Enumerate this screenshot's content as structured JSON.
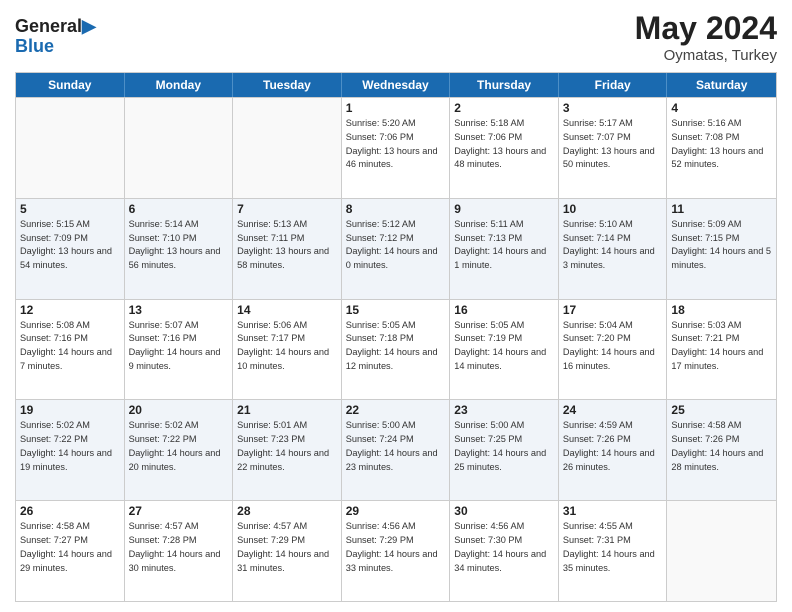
{
  "logo": {
    "line1": "General",
    "line2": "Blue"
  },
  "title": {
    "month_year": "May 2024",
    "location": "Oymatas, Turkey"
  },
  "weekdays": [
    "Sunday",
    "Monday",
    "Tuesday",
    "Wednesday",
    "Thursday",
    "Friday",
    "Saturday"
  ],
  "rows": [
    [
      {
        "day": "",
        "sunrise": "",
        "sunset": "",
        "daylight": ""
      },
      {
        "day": "",
        "sunrise": "",
        "sunset": "",
        "daylight": ""
      },
      {
        "day": "",
        "sunrise": "",
        "sunset": "",
        "daylight": ""
      },
      {
        "day": "1",
        "sunrise": "Sunrise: 5:20 AM",
        "sunset": "Sunset: 7:06 PM",
        "daylight": "Daylight: 13 hours and 46 minutes."
      },
      {
        "day": "2",
        "sunrise": "Sunrise: 5:18 AM",
        "sunset": "Sunset: 7:06 PM",
        "daylight": "Daylight: 13 hours and 48 minutes."
      },
      {
        "day": "3",
        "sunrise": "Sunrise: 5:17 AM",
        "sunset": "Sunset: 7:07 PM",
        "daylight": "Daylight: 13 hours and 50 minutes."
      },
      {
        "day": "4",
        "sunrise": "Sunrise: 5:16 AM",
        "sunset": "Sunset: 7:08 PM",
        "daylight": "Daylight: 13 hours and 52 minutes."
      }
    ],
    [
      {
        "day": "5",
        "sunrise": "Sunrise: 5:15 AM",
        "sunset": "Sunset: 7:09 PM",
        "daylight": "Daylight: 13 hours and 54 minutes."
      },
      {
        "day": "6",
        "sunrise": "Sunrise: 5:14 AM",
        "sunset": "Sunset: 7:10 PM",
        "daylight": "Daylight: 13 hours and 56 minutes."
      },
      {
        "day": "7",
        "sunrise": "Sunrise: 5:13 AM",
        "sunset": "Sunset: 7:11 PM",
        "daylight": "Daylight: 13 hours and 58 minutes."
      },
      {
        "day": "8",
        "sunrise": "Sunrise: 5:12 AM",
        "sunset": "Sunset: 7:12 PM",
        "daylight": "Daylight: 14 hours and 0 minutes."
      },
      {
        "day": "9",
        "sunrise": "Sunrise: 5:11 AM",
        "sunset": "Sunset: 7:13 PM",
        "daylight": "Daylight: 14 hours and 1 minute."
      },
      {
        "day": "10",
        "sunrise": "Sunrise: 5:10 AM",
        "sunset": "Sunset: 7:14 PM",
        "daylight": "Daylight: 14 hours and 3 minutes."
      },
      {
        "day": "11",
        "sunrise": "Sunrise: 5:09 AM",
        "sunset": "Sunset: 7:15 PM",
        "daylight": "Daylight: 14 hours and 5 minutes."
      }
    ],
    [
      {
        "day": "12",
        "sunrise": "Sunrise: 5:08 AM",
        "sunset": "Sunset: 7:16 PM",
        "daylight": "Daylight: 14 hours and 7 minutes."
      },
      {
        "day": "13",
        "sunrise": "Sunrise: 5:07 AM",
        "sunset": "Sunset: 7:16 PM",
        "daylight": "Daylight: 14 hours and 9 minutes."
      },
      {
        "day": "14",
        "sunrise": "Sunrise: 5:06 AM",
        "sunset": "Sunset: 7:17 PM",
        "daylight": "Daylight: 14 hours and 10 minutes."
      },
      {
        "day": "15",
        "sunrise": "Sunrise: 5:05 AM",
        "sunset": "Sunset: 7:18 PM",
        "daylight": "Daylight: 14 hours and 12 minutes."
      },
      {
        "day": "16",
        "sunrise": "Sunrise: 5:05 AM",
        "sunset": "Sunset: 7:19 PM",
        "daylight": "Daylight: 14 hours and 14 minutes."
      },
      {
        "day": "17",
        "sunrise": "Sunrise: 5:04 AM",
        "sunset": "Sunset: 7:20 PM",
        "daylight": "Daylight: 14 hours and 16 minutes."
      },
      {
        "day": "18",
        "sunrise": "Sunrise: 5:03 AM",
        "sunset": "Sunset: 7:21 PM",
        "daylight": "Daylight: 14 hours and 17 minutes."
      }
    ],
    [
      {
        "day": "19",
        "sunrise": "Sunrise: 5:02 AM",
        "sunset": "Sunset: 7:22 PM",
        "daylight": "Daylight: 14 hours and 19 minutes."
      },
      {
        "day": "20",
        "sunrise": "Sunrise: 5:02 AM",
        "sunset": "Sunset: 7:22 PM",
        "daylight": "Daylight: 14 hours and 20 minutes."
      },
      {
        "day": "21",
        "sunrise": "Sunrise: 5:01 AM",
        "sunset": "Sunset: 7:23 PM",
        "daylight": "Daylight: 14 hours and 22 minutes."
      },
      {
        "day": "22",
        "sunrise": "Sunrise: 5:00 AM",
        "sunset": "Sunset: 7:24 PM",
        "daylight": "Daylight: 14 hours and 23 minutes."
      },
      {
        "day": "23",
        "sunrise": "Sunrise: 5:00 AM",
        "sunset": "Sunset: 7:25 PM",
        "daylight": "Daylight: 14 hours and 25 minutes."
      },
      {
        "day": "24",
        "sunrise": "Sunrise: 4:59 AM",
        "sunset": "Sunset: 7:26 PM",
        "daylight": "Daylight: 14 hours and 26 minutes."
      },
      {
        "day": "25",
        "sunrise": "Sunrise: 4:58 AM",
        "sunset": "Sunset: 7:26 PM",
        "daylight": "Daylight: 14 hours and 28 minutes."
      }
    ],
    [
      {
        "day": "26",
        "sunrise": "Sunrise: 4:58 AM",
        "sunset": "Sunset: 7:27 PM",
        "daylight": "Daylight: 14 hours and 29 minutes."
      },
      {
        "day": "27",
        "sunrise": "Sunrise: 4:57 AM",
        "sunset": "Sunset: 7:28 PM",
        "daylight": "Daylight: 14 hours and 30 minutes."
      },
      {
        "day": "28",
        "sunrise": "Sunrise: 4:57 AM",
        "sunset": "Sunset: 7:29 PM",
        "daylight": "Daylight: 14 hours and 31 minutes."
      },
      {
        "day": "29",
        "sunrise": "Sunrise: 4:56 AM",
        "sunset": "Sunset: 7:29 PM",
        "daylight": "Daylight: 14 hours and 33 minutes."
      },
      {
        "day": "30",
        "sunrise": "Sunrise: 4:56 AM",
        "sunset": "Sunset: 7:30 PM",
        "daylight": "Daylight: 14 hours and 34 minutes."
      },
      {
        "day": "31",
        "sunrise": "Sunrise: 4:55 AM",
        "sunset": "Sunset: 7:31 PM",
        "daylight": "Daylight: 14 hours and 35 minutes."
      },
      {
        "day": "",
        "sunrise": "",
        "sunset": "",
        "daylight": ""
      }
    ]
  ]
}
